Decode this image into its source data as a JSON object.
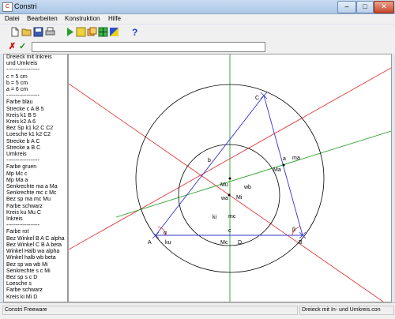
{
  "window": {
    "title": "Constri",
    "minimize": "‒",
    "maximize": "□",
    "close": "✕"
  },
  "menu": [
    "Datei",
    "Bearbeiten",
    "Konstruktion",
    "Hilfe"
  ],
  "toolbar_icons": [
    "new-file-icon",
    "open-folder-icon",
    "save-icon",
    "print-icon",
    "run-icon",
    "step-icon",
    "copy-icon",
    "grid-icon",
    "color-icon",
    "help-icon"
  ],
  "commandbar": {
    "cancel": "✗",
    "confirm": "✓",
    "input_value": ""
  },
  "script_lines": [
    "Dreieck mit Inkreis",
    "und Umkreis",
    "------------------",
    "c = 5 cm",
    "b = 5 cm",
    "a = 6 cm",
    "------------------",
    "Farbe blau",
    "Strecke c A B 5",
    "Kreis k1 B 5",
    "Kreis k2 A 6",
    "Bez Sp k1 k2 C C2",
    "Loesche k1 k2 C2",
    "Strecke b A C",
    "Strecke a B C",
    "Umkreis",
    "------------------",
    "Farbe gruen",
    "Mp Mc c",
    "Mp Ma a",
    "Senkrechte ma a Ma",
    "Senkrechte mc c Mc",
    "Bez sp ma mc Mu",
    "Farbe schwarz",
    "Kreis ku Mu C",
    "Inkreis",
    "------------------",
    "Farbe rot",
    "Bez Winkel B A C alpha",
    "Bez Winkel C B A beta",
    "Winkel Halb wa alpha",
    "Winkel halb wb beta",
    "Bez sp wa wb Mi",
    "Senkrechte s c Mi",
    "Bez sp  s c D",
    "Loesche s",
    "Farbe schwarz",
    "Kreis ki Mi D"
  ],
  "canvas_labels": {
    "A": "A",
    "B": "B",
    "C": "C",
    "D": "D",
    "Mc": "Mc",
    "Ma": "Ma",
    "Mu": "Mu",
    "Mi": "Mi",
    "a": "a",
    "b": "b",
    "c": "c",
    "ma": "ma",
    "mc": "mc",
    "wa": "wa",
    "wb": "wb",
    "ku": "ku",
    "ki": "ki",
    "alpha": "α",
    "beta": "β"
  },
  "colors": {
    "blue": "#3333cc",
    "red": "#e23b3b",
    "green": "#2ca02c",
    "black": "#000000"
  },
  "status": {
    "left": "Constri Freeware",
    "right": "Dreieck mit In- und Umkreis.con"
  }
}
